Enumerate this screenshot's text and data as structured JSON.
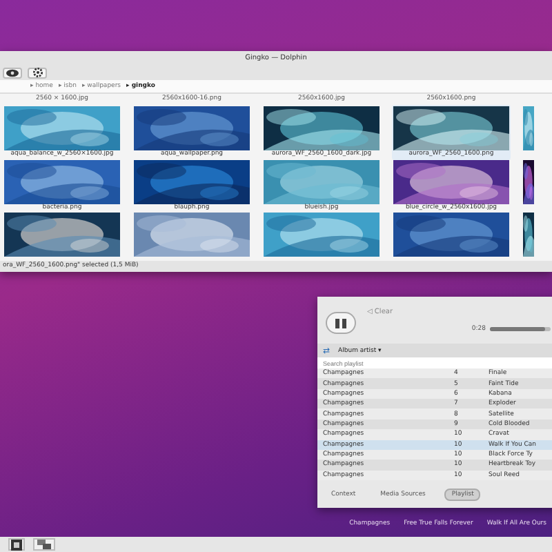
{
  "file_manager": {
    "title": "Gingko — Dolphin",
    "breadcrumb": [
      "▸ home",
      "▸ isbn",
      "▸ wallpapers",
      "▸ gingko"
    ],
    "top_labels": [
      "2560 × 1600.jpg",
      "2560x1600-16.png",
      "2560x1600.jpg",
      "2560x1600.png"
    ],
    "files": [
      {
        "kind": "file",
        "name": "aqua_balance_w_2560×1600.jpg",
        "selected": false
      },
      {
        "kind": "file",
        "name": "aqua_wallpaper.png",
        "selected": false
      },
      {
        "kind": "file",
        "name": "aurora_WF_2560_1600_dark.jpg",
        "selected": false
      },
      {
        "kind": "file",
        "name": "aurora_WF_2560_1600.png",
        "selected": true
      },
      {
        "kind": "picture",
        "selected": false
      },
      {
        "kind": "file",
        "name": "bacteria.png",
        "selected": false
      },
      {
        "kind": "file",
        "name": "blauph.png",
        "selected": false
      },
      {
        "kind": "file",
        "name": "blueish.jpg",
        "selected": false
      },
      {
        "kind": "file",
        "name": "blue_circle_w_2560x1600.jpg",
        "selected": false
      },
      {
        "kind": "picture",
        "selected": false
      },
      {
        "kind": "picture",
        "selected": false
      },
      {
        "kind": "picture",
        "selected": false
      },
      {
        "kind": "picture",
        "selected": false
      },
      {
        "kind": "picture",
        "selected": false
      },
      {
        "kind": "picture",
        "selected": false
      }
    ],
    "status_bar": "ora_WF_2560_1600.png\" selected (1,5 MiB)"
  },
  "player": {
    "clear": "◁ Clear",
    "back": "⇄",
    "time": "0:28",
    "volume": {
      "level": 0.9
    },
    "grouping": "Album artist ▾",
    "search": {
      "placeholder": "Search playlist"
    },
    "tracks": [
      {
        "artist": "Champagnes",
        "number": "4",
        "title": "Finale",
        "selected": false
      },
      {
        "artist": "Champagnes",
        "number": "5",
        "title": "Faint Tide",
        "selected": false
      },
      {
        "artist": "Champagnes",
        "number": "6",
        "title": "Kabana",
        "selected": false
      },
      {
        "artist": "Champagnes",
        "number": "7",
        "title": "Exploder",
        "selected": false
      },
      {
        "artist": "Champagnes",
        "number": "8",
        "title": "Satellite",
        "selected": false
      },
      {
        "artist": "Champagnes",
        "number": "9",
        "title": "Cold Blooded",
        "selected": false
      },
      {
        "artist": "Champagnes",
        "number": "10",
        "title": "Cravat",
        "selected": false
      },
      {
        "artist": "Champagnes",
        "number": "10",
        "title": "Walk If You Can",
        "selected": true
      },
      {
        "artist": "Champagnes",
        "number": "10",
        "title": "Black Force Ty",
        "selected": false
      },
      {
        "artist": "Champagnes",
        "number": "10",
        "title": "Heartbreak Toy",
        "selected": false
      },
      {
        "artist": "Champagnes",
        "number": "10",
        "title": "Soul Reed",
        "selected": false
      }
    ],
    "tabs": [
      {
        "label": "Context",
        "selected": false
      },
      {
        "label": "Media Sources",
        "selected": false
      },
      {
        "label": "Playlist",
        "selected": true
      }
    ]
  },
  "now_playing": [
    "Champagnes",
    "Free True Falls Forever",
    "Walk If All Are Ours"
  ]
}
